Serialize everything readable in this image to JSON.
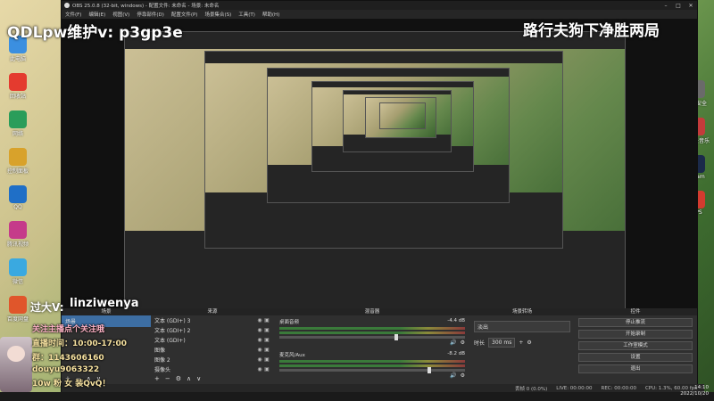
{
  "window": {
    "title": "OBS 25.0.8 (32-bit, windows) - 配置文件: 未命名 - 场景: 未命名",
    "menu": [
      "文件(F)",
      "编辑(E)",
      "视图(V)",
      "停靠部件(D)",
      "配置文件(P)",
      "场景集合(S)",
      "工具(T)",
      "帮助(H)"
    ]
  },
  "overlays": {
    "top_left": "QDLpw维护v:  p3gp3e",
    "top_right": "路行夫狗下净胜两局",
    "name": "linziwenya",
    "side": "过大V:",
    "promo": [
      "关注主播点个关注哦",
      "直播时间：10:00-17:00",
      "群：1143606160",
      "douyu9063322",
      "10w 粉 女 装QvQ！"
    ]
  },
  "docks": {
    "scenes": {
      "header": "场景",
      "items": [
        "场景"
      ]
    },
    "sources": {
      "header": "来源",
      "items": [
        "文本 (GDI+) 3",
        "文本 (GDI+) 2",
        "文本 (GDI+)",
        "图像",
        "图像 2",
        "摄像头"
      ]
    },
    "mixer": {
      "header": "混音器",
      "channels": [
        {
          "name": "桌面音频",
          "db": "-4.4 dB"
        },
        {
          "name": "麦克风/Aux",
          "db": "-8.2 dB"
        }
      ]
    },
    "transitions": {
      "header": "场景转场",
      "type": "淡出",
      "duration_label": "时长",
      "duration": "300 ms"
    },
    "controls": {
      "header": "控件",
      "buttons": [
        "停止推流",
        "开始录制",
        "工作室模式",
        "设置",
        "退出"
      ]
    }
  },
  "status": {
    "live": "LIVE: 00:00:00",
    "rec": "REC: 00:00:00",
    "cpu": "CPU: 1.3%, 60.00 fps",
    "dropped": "丢帧 0 (0.0%)"
  },
  "clock": {
    "time": "14:10",
    "date": "2022/10/20"
  },
  "desktop_icons": [
    "此电脑",
    "回收站",
    "网络",
    "控制面板",
    "QQ",
    "腾讯视频",
    "微信",
    "百度网盘",
    "火绒安全",
    "网易云音乐",
    "Steam",
    "WPS"
  ]
}
